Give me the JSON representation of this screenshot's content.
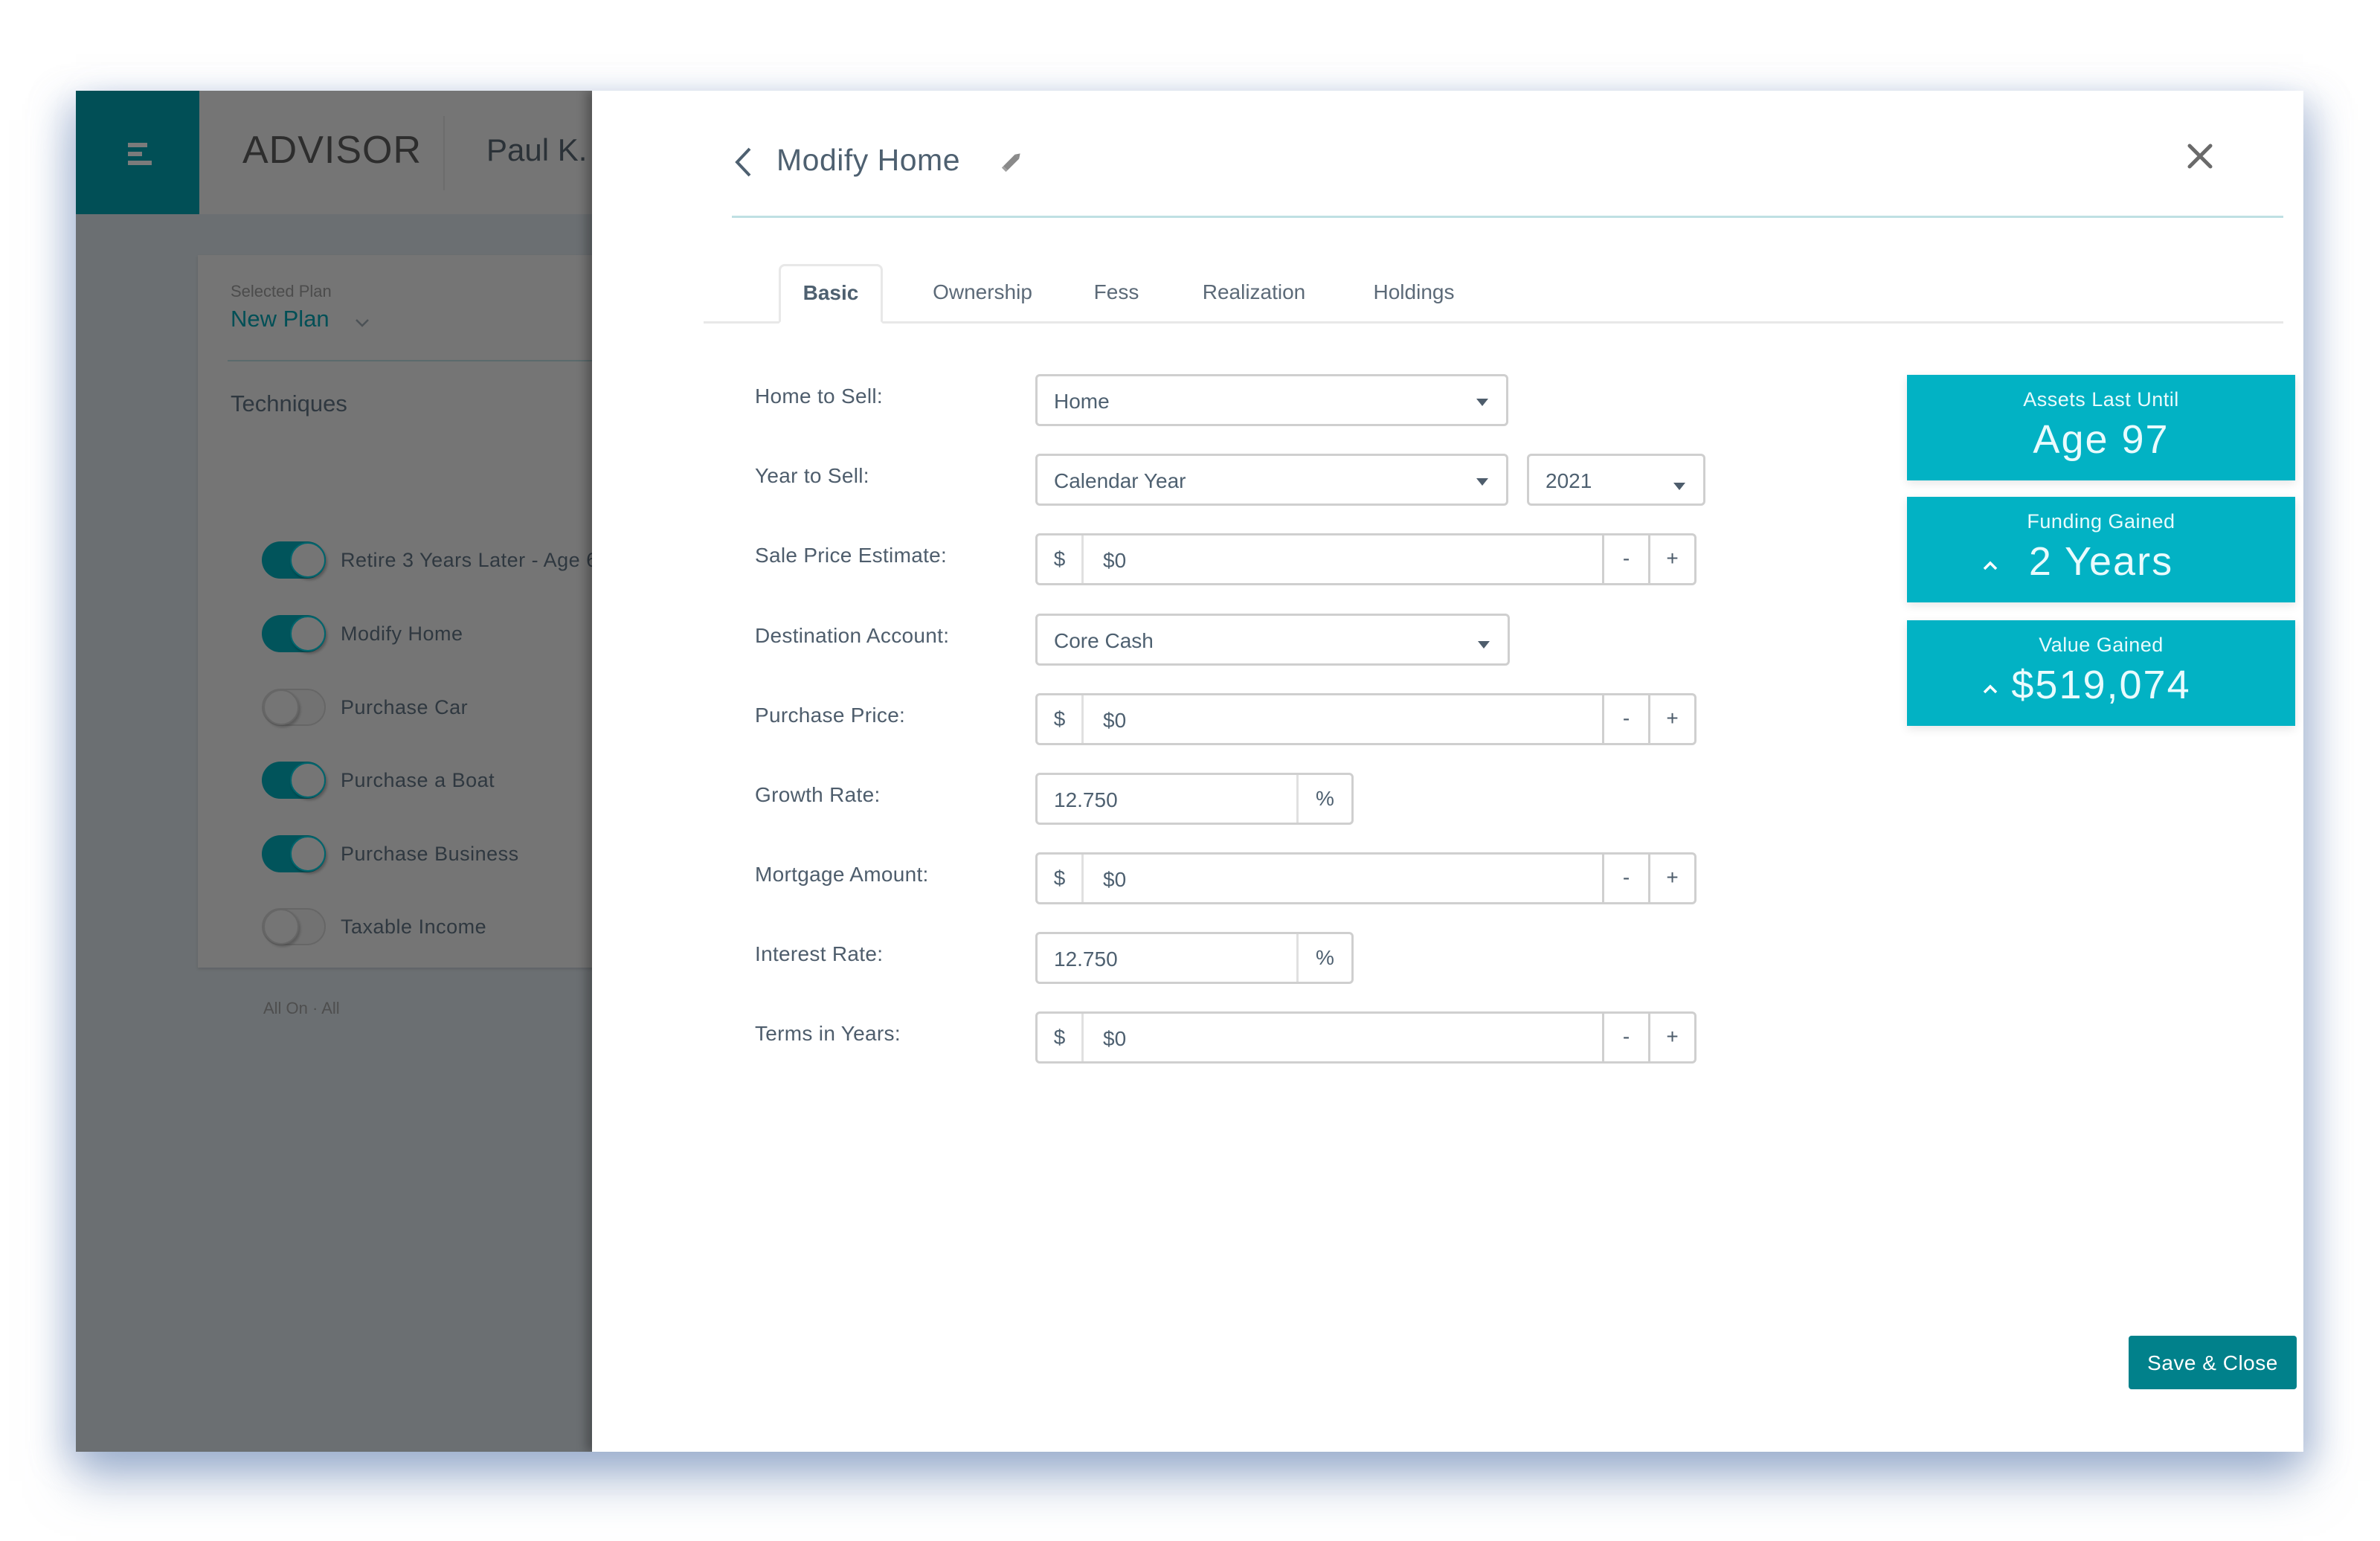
{
  "app": {
    "brand": "ADVISOR",
    "user_name": "Paul K.",
    "selected_plan_label": "Selected Plan",
    "selected_plan": "New Plan",
    "techniques_title": "Techniques",
    "techniques": [
      {
        "label": "Retire 3 Years Later - Age 6",
        "on": true
      },
      {
        "label": "Modify Home",
        "on": true
      },
      {
        "label": "Purchase Car",
        "on": false
      },
      {
        "label": "Purchase a Boat",
        "on": true
      },
      {
        "label": "Purchase Business",
        "on": true
      },
      {
        "label": "Taxable Income",
        "on": false
      }
    ],
    "all_on_text": "All On · All"
  },
  "modal": {
    "title": "Modify Home",
    "tabs": [
      {
        "label": "Basic",
        "active": true
      },
      {
        "label": "Ownership",
        "active": false
      },
      {
        "label": "Fess",
        "active": false
      },
      {
        "label": "Realization",
        "active": false
      },
      {
        "label": "Holdings",
        "active": false
      }
    ],
    "fields": {
      "home_to_sell": {
        "label": "Home to Sell:",
        "value": "Home"
      },
      "year_to_sell": {
        "label": "Year to Sell:",
        "value": "Calendar Year",
        "year": "2021"
      },
      "sale_price_estimate": {
        "label": "Sale Price Estimate:",
        "prefix": "$",
        "value": "$0"
      },
      "destination_account": {
        "label": "Destination Account:",
        "value": "Core Cash"
      },
      "purchase_price": {
        "label": "Purchase Price:",
        "prefix": "$",
        "value": "$0"
      },
      "growth_rate": {
        "label": "Growth Rate:",
        "value": "12.750",
        "suffix": "%"
      },
      "mortgage_amount": {
        "label": "Mortgage Amount:",
        "prefix": "$",
        "value": "$0"
      },
      "interest_rate": {
        "label": "Interest Rate:",
        "value": "12.750",
        "suffix": "%"
      },
      "terms_in_years": {
        "label": "Terms in Years:",
        "prefix": "$",
        "value": "$0"
      }
    },
    "stepper": {
      "minus": "-",
      "plus": "+"
    },
    "stats": [
      {
        "label": "Assets Last Until",
        "value": "Age 97",
        "trend": null
      },
      {
        "label": "Funding Gained",
        "value": "2 Years",
        "trend": "up"
      },
      {
        "label": "Value Gained",
        "value": "$519,074",
        "trend": "up"
      }
    ],
    "save_label": "Save & Close"
  },
  "colors": {
    "brand_teal_dark": "#014f56",
    "accent_teal": "#02b2c4",
    "button_teal": "#01818b"
  }
}
